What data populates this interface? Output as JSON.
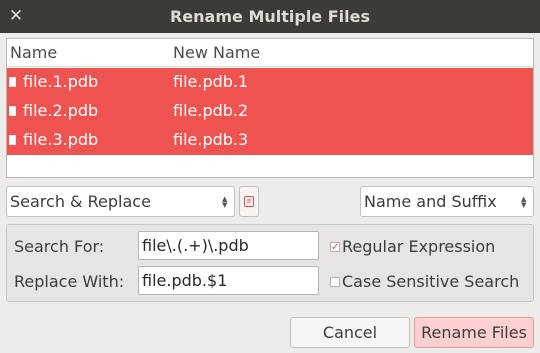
{
  "window": {
    "title": "Rename Multiple Files",
    "close_glyph": "✕"
  },
  "file_list": {
    "columns": [
      "Name",
      "New Name"
    ],
    "rows": [
      {
        "name": "file.1.pdb",
        "new_name": "file.pdb.1"
      },
      {
        "name": "file.2.pdb",
        "new_name": "file.pdb.2"
      },
      {
        "name": "file.3.pdb",
        "new_name": "file.pdb.3"
      }
    ],
    "selected_color": "#ef5350"
  },
  "mode_select": {
    "value": "Search & Replace"
  },
  "scope_select": {
    "value": "Name and Suffix"
  },
  "form": {
    "search_label": "Search For:",
    "search_value": "file\\.(.+)\\.pdb",
    "replace_label": "Replace With:",
    "replace_value": "file.pdb.$1",
    "regex_label": "Regular Expression",
    "regex_checked": true,
    "case_label": "Case Sensitive Search",
    "case_checked": false
  },
  "buttons": {
    "cancel": "Cancel",
    "rename": "Rename Files"
  },
  "colors": {
    "titlebar": "#3c3b37",
    "accent": "#ef5350",
    "rename_button": "#fbd0cf"
  }
}
